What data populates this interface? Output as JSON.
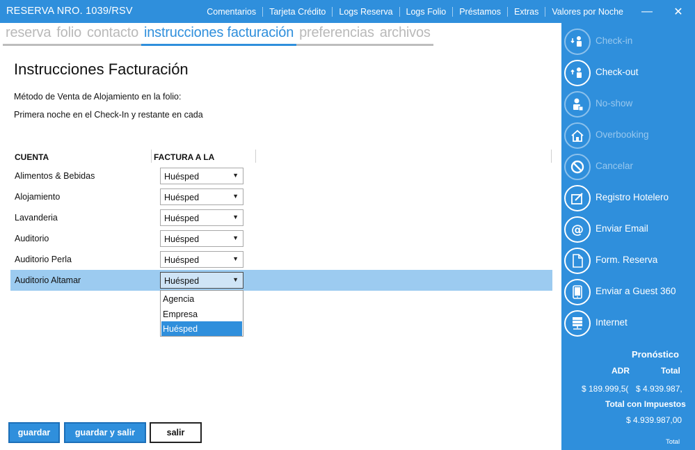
{
  "window": {
    "title": "RESERVA NRO. 1039/RSV",
    "nav": [
      "Comentarios",
      "Tarjeta Crédito",
      "Logs Reserva",
      "Logs Folio",
      "Préstamos",
      "Extras",
      "Valores por Noche"
    ],
    "minimize_glyph": "—",
    "close_glyph": "✕"
  },
  "tabs": [
    "reserva",
    "folio",
    "contacto",
    "instrucciones facturación",
    "preferencias",
    "archivos"
  ],
  "active_tab": "instrucciones facturación",
  "main": {
    "heading": "Instrucciones Facturación",
    "desc1": "Método de Venta de Alojamiento en la folio:",
    "desc2": "Primera noche en el Check-In y restante en cada",
    "columns": {
      "cuenta": "CUENTA",
      "factura": "FACTURA A LA"
    },
    "rows": [
      {
        "account": "Alimentos & Bebidas",
        "value": "Huésped"
      },
      {
        "account": "Alojamiento",
        "value": "Huésped"
      },
      {
        "account": "Lavanderia",
        "value": "Huésped"
      },
      {
        "account": "Auditorio",
        "value": "Huésped"
      },
      {
        "account": "Auditorio Perla",
        "value": "Huésped"
      },
      {
        "account": "Auditorio Altamar",
        "value": "Huésped"
      }
    ],
    "selected_row": "Auditorio Altamar",
    "dropdown_options": [
      "Agencia",
      "Empresa",
      "Huésped"
    ],
    "dropdown_selected": "Huésped"
  },
  "buttons": {
    "save": "guardar",
    "save_exit": "guardar y salir",
    "exit": "salir"
  },
  "side_actions": [
    {
      "label": "Check-in",
      "icon": "check-in-icon",
      "enabled": false
    },
    {
      "label": "Check-out",
      "icon": "check-out-icon",
      "enabled": true
    },
    {
      "label": "No-show",
      "icon": "no-show-icon",
      "enabled": false
    },
    {
      "label": "Overbooking",
      "icon": "overbooking-icon",
      "enabled": false
    },
    {
      "label": "Cancelar",
      "icon": "cancel-icon",
      "enabled": false
    },
    {
      "label": "Registro Hotelero",
      "icon": "hotel-register-icon",
      "enabled": true
    },
    {
      "label": "Enviar Email",
      "icon": "email-at-icon",
      "enabled": true
    },
    {
      "label": "Form. Reserva",
      "icon": "document-icon",
      "enabled": true
    },
    {
      "label": "Enviar a Guest 360",
      "icon": "tablet-icon",
      "enabled": true
    },
    {
      "label": "Internet",
      "icon": "server-network-icon",
      "enabled": true
    }
  ],
  "summary": {
    "title": "Pronóstico",
    "adr_label": "ADR",
    "total_label": "Total",
    "adr_value": "$ 189.999,5(",
    "total_value": "$ 4.939.987,",
    "tax_label": "Total con Impuestos",
    "tax_value": "$ 4.939.987,00",
    "footer_label": "Total"
  },
  "colors": {
    "accent": "#2f8fdc",
    "selected_row": "#9ccbf0",
    "tab_inactive": "#b9b9b9"
  }
}
